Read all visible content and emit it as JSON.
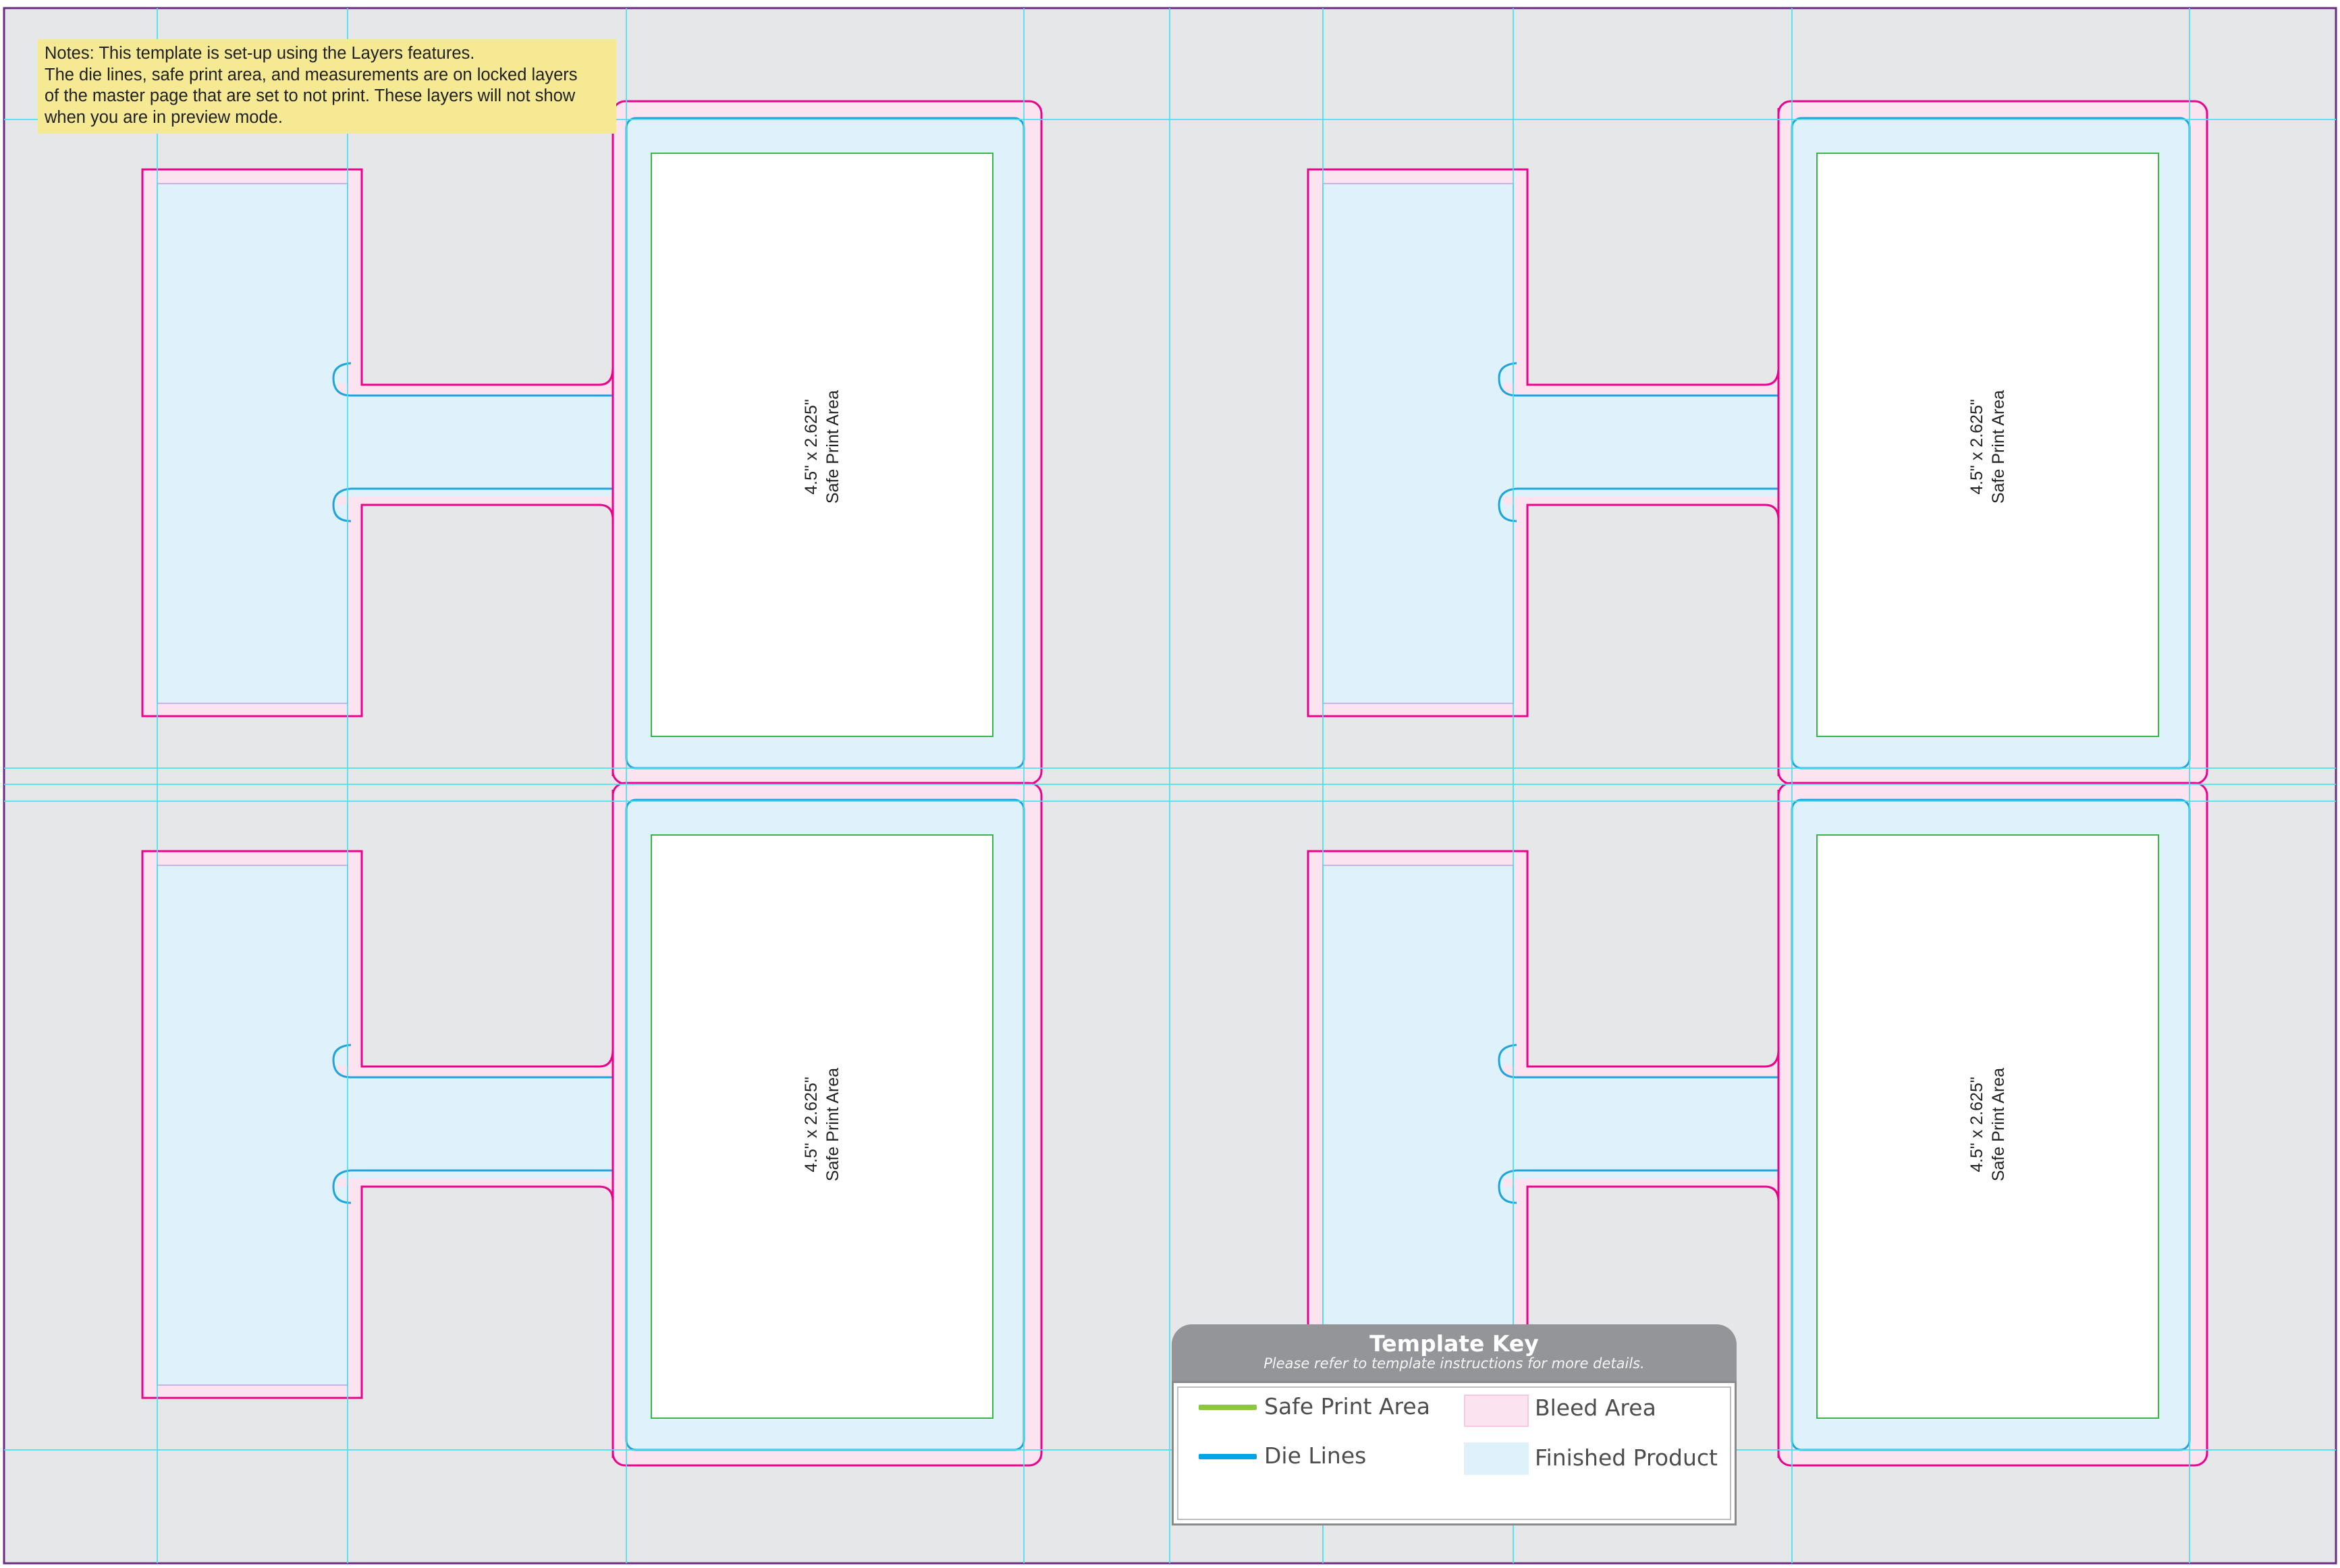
{
  "notes": {
    "lines": [
      "Notes:  This template is set-up using the Layers features.",
      "The die lines, safe print area, and measurements are on locked layers",
      "of the master page that are set to not print.  These layers will not show",
      "when you are in preview mode."
    ]
  },
  "panels": [
    {
      "size": "4.5\" x 2.625\"",
      "label": "Safe Print Area"
    },
    {
      "size": "4.5\" x 2.625\"",
      "label": "Safe Print Area"
    },
    {
      "size": "4.5\" x 2.625\"",
      "label": "Safe Print Area"
    },
    {
      "size": "4.5\" x 2.625\"",
      "label": "Safe Print Area"
    }
  ],
  "key": {
    "title": "Template Key",
    "subtitle": "Please refer to template instructions for more details.",
    "items": {
      "safe_print": "Safe Print Area",
      "die_lines": "Die Lines",
      "bleed": "Bleed Area",
      "finished": "Finished Product"
    }
  },
  "colors": {
    "page_background": "#e6e7e8",
    "page_border": "#6a2c82",
    "bleed_line": "#ec008c",
    "bleed_fill": "#fbe3f0",
    "finished_fill": "#dff1fa",
    "die_line": "#1ea5dc",
    "safe_line": "#39b54a",
    "guide": "#49e1ef",
    "safe_swatch": "#8dc63f",
    "die_swatch": "#00a5e5",
    "notes_background": "#f5ea93",
    "key_header": "#939598"
  }
}
